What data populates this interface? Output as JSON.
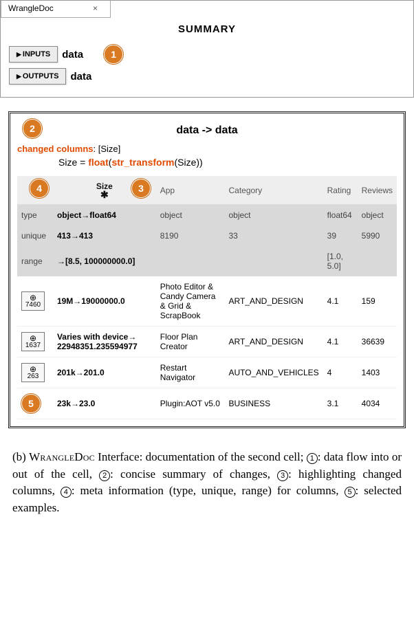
{
  "tab": {
    "title": "WrangleDoc",
    "close": "×"
  },
  "summary_heading": "SUMMARY",
  "inputs_btn": "INPUTS",
  "outputs_btn": "OUTPUTS",
  "inputs_text": "data",
  "outputs_text": "data",
  "annotations": {
    "b1": "1",
    "b2": "2",
    "b3": "3",
    "b4": "4",
    "b5": "5"
  },
  "flow_title": "data -> data",
  "changed_label": "changed columns",
  "changed_value": ": [Size]",
  "code_prefix": "Size = ",
  "code_fn1": "float",
  "code_paren1": "(",
  "code_fn2": "str_transform",
  "code_paren2": "(Size))",
  "columns": {
    "blank": "",
    "size": "Size",
    "star": "✱",
    "app": "App",
    "category": "Category",
    "rating": "Rating",
    "reviews": "Reviews"
  },
  "meta": {
    "type": {
      "label": "type",
      "size": "object→float64",
      "app": "object",
      "category": "object",
      "rating": "float64",
      "reviews": "object"
    },
    "unique": {
      "label": "unique",
      "size": "413→413",
      "app": "8190",
      "category": "33",
      "rating": "39",
      "reviews": "5990"
    },
    "range": {
      "label": "range",
      "size": "→[8.5, 100000000.0]",
      "app": "",
      "category": "",
      "rating": "[1.0, 5.0]",
      "reviews": ""
    }
  },
  "rows": [
    {
      "zoom": "7460",
      "size": "19M→19000000.0",
      "app": "Photo Editor & Candy Camera & Grid & ScrapBook",
      "category": "ART_AND_DESIGN",
      "rating": "4.1",
      "reviews": "159"
    },
    {
      "zoom": "1637",
      "size": "Varies with device→ 22948351.235594977",
      "app": "Floor Plan Creator",
      "category": "ART_AND_DESIGN",
      "rating": "4.1",
      "reviews": "36639"
    },
    {
      "zoom": "263",
      "size": "201k→201.0",
      "app": "Restart Navigator",
      "category": "AUTO_AND_VEHICLES",
      "rating": "4",
      "reviews": "1403"
    },
    {
      "zoom": "",
      "size": "23k→23.0",
      "app": "Plugin:AOT v5.0",
      "category": "BUSINESS",
      "rating": "3.1",
      "reviews": "4034"
    }
  ],
  "magnifier": "⊕",
  "caption": {
    "prefix": "(b) ",
    "sc1": "WrangleDoc",
    "mid1": " Interface: documentation of the second cell; ",
    "c1": "1",
    "t1": ": data flow into or out of the cell, ",
    "c2": "2",
    "t2": ": concise summary of changes, ",
    "c3": "3",
    "t3": ": highlighting changed columns, ",
    "c4": "4",
    "t4": ": meta information (type, unique, range) for columns, ",
    "c5": "5",
    "t5": ": selected examples."
  }
}
